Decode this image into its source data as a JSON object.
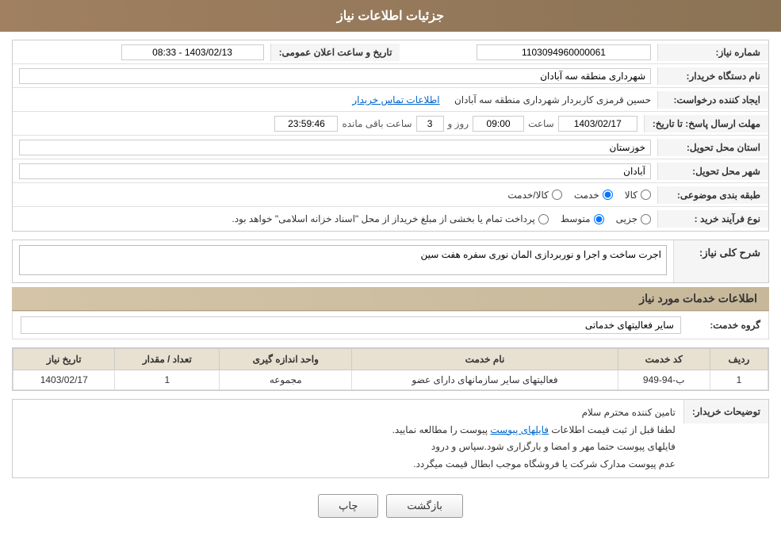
{
  "header": {
    "title": "جزئیات اطلاعات نیاز"
  },
  "fields": {
    "need_number_label": "شماره نیاز:",
    "need_number_value": "1103094960000061",
    "announcement_date_label": "تاریخ و ساعت اعلان عمومی:",
    "announcement_date_value": "1403/02/13 - 08:33",
    "buyer_org_label": "نام دستگاه خریدار:",
    "buyer_org_value": "شهرداری منطقه سه آبادان",
    "creator_label": "ایجاد کننده درخواست:",
    "creator_value": "حسین قرمزی کاربردار شهرداری منطقه سه آبادان",
    "contact_link": "اطلاعات تماس خریدار",
    "deadline_label": "مهلت ارسال پاسخ: تا تاریخ:",
    "deadline_date": "1403/02/17",
    "deadline_time_label": "ساعت",
    "deadline_time": "09:00",
    "deadline_days_label": "روز و",
    "deadline_days": "3",
    "deadline_remaining_label": "ساعت باقی مانده",
    "deadline_remaining": "23:59:46",
    "province_label": "استان محل تحویل:",
    "province_value": "خوزستان",
    "city_label": "شهر محل تحویل:",
    "city_value": "آبادان",
    "category_label": "طبقه بندی موضوعی:",
    "category_options": [
      "کالا",
      "خدمت",
      "کالا/خدمت"
    ],
    "category_selected": "خدمت",
    "process_label": "نوع فرآیند خرید :",
    "process_options": [
      "جزیی",
      "متوسط",
      "بازرداخت تمام یا بخشی از مبلغ خریدار از محل \"اسناد خزانه اسلامی\" خواهد بود."
    ],
    "process_selected": "متوسط",
    "process_note": "پرداخت تمام یا بخشی از مبلغ خریداز از محل \"اسناد خزانه اسلامی\" خواهد بود.",
    "need_desc_label": "شرح کلی نیاز:",
    "need_desc_value": "اجرت ساخت و اجرا و نوربردازی المان نوری سفره هفت سین",
    "services_header": "اطلاعات خدمات مورد نیاز",
    "group_label": "گروه خدمت:",
    "group_value": "سایر فعالیتهای خدماتی",
    "table": {
      "headers": [
        "ردیف",
        "کد خدمت",
        "نام خدمت",
        "واحد اندازه گیری",
        "تعداد / مقدار",
        "تاریخ نیاز"
      ],
      "rows": [
        {
          "row_num": "1",
          "service_code": "ب-94-949",
          "service_name": "فعالیتهای سایر سازمانهای دارای عضو",
          "unit": "مجموعه",
          "quantity": "1",
          "date": "1403/02/17"
        }
      ]
    },
    "buyer_notes_label": "توضیحات خریدار:",
    "buyer_notes_line1": "تامین کننده محترم سلام",
    "buyer_notes_line2": "لطفا قبل از ثبت قیمت اطلاعات فایلهای پیوست را مطالعه نمایید.",
    "buyer_notes_line2_link": "فایلهای پیوست",
    "buyer_notes_line3": "فایلهای پیوست حتما مهر و امضا و بارگزاری شود.سپاس و درود",
    "buyer_notes_line4": "عدم پیوست مدارک شرکت یا فروشگاه موجب ابطال قیمت میگردد.",
    "btn_print": "چاپ",
    "btn_back": "بازگشت"
  }
}
